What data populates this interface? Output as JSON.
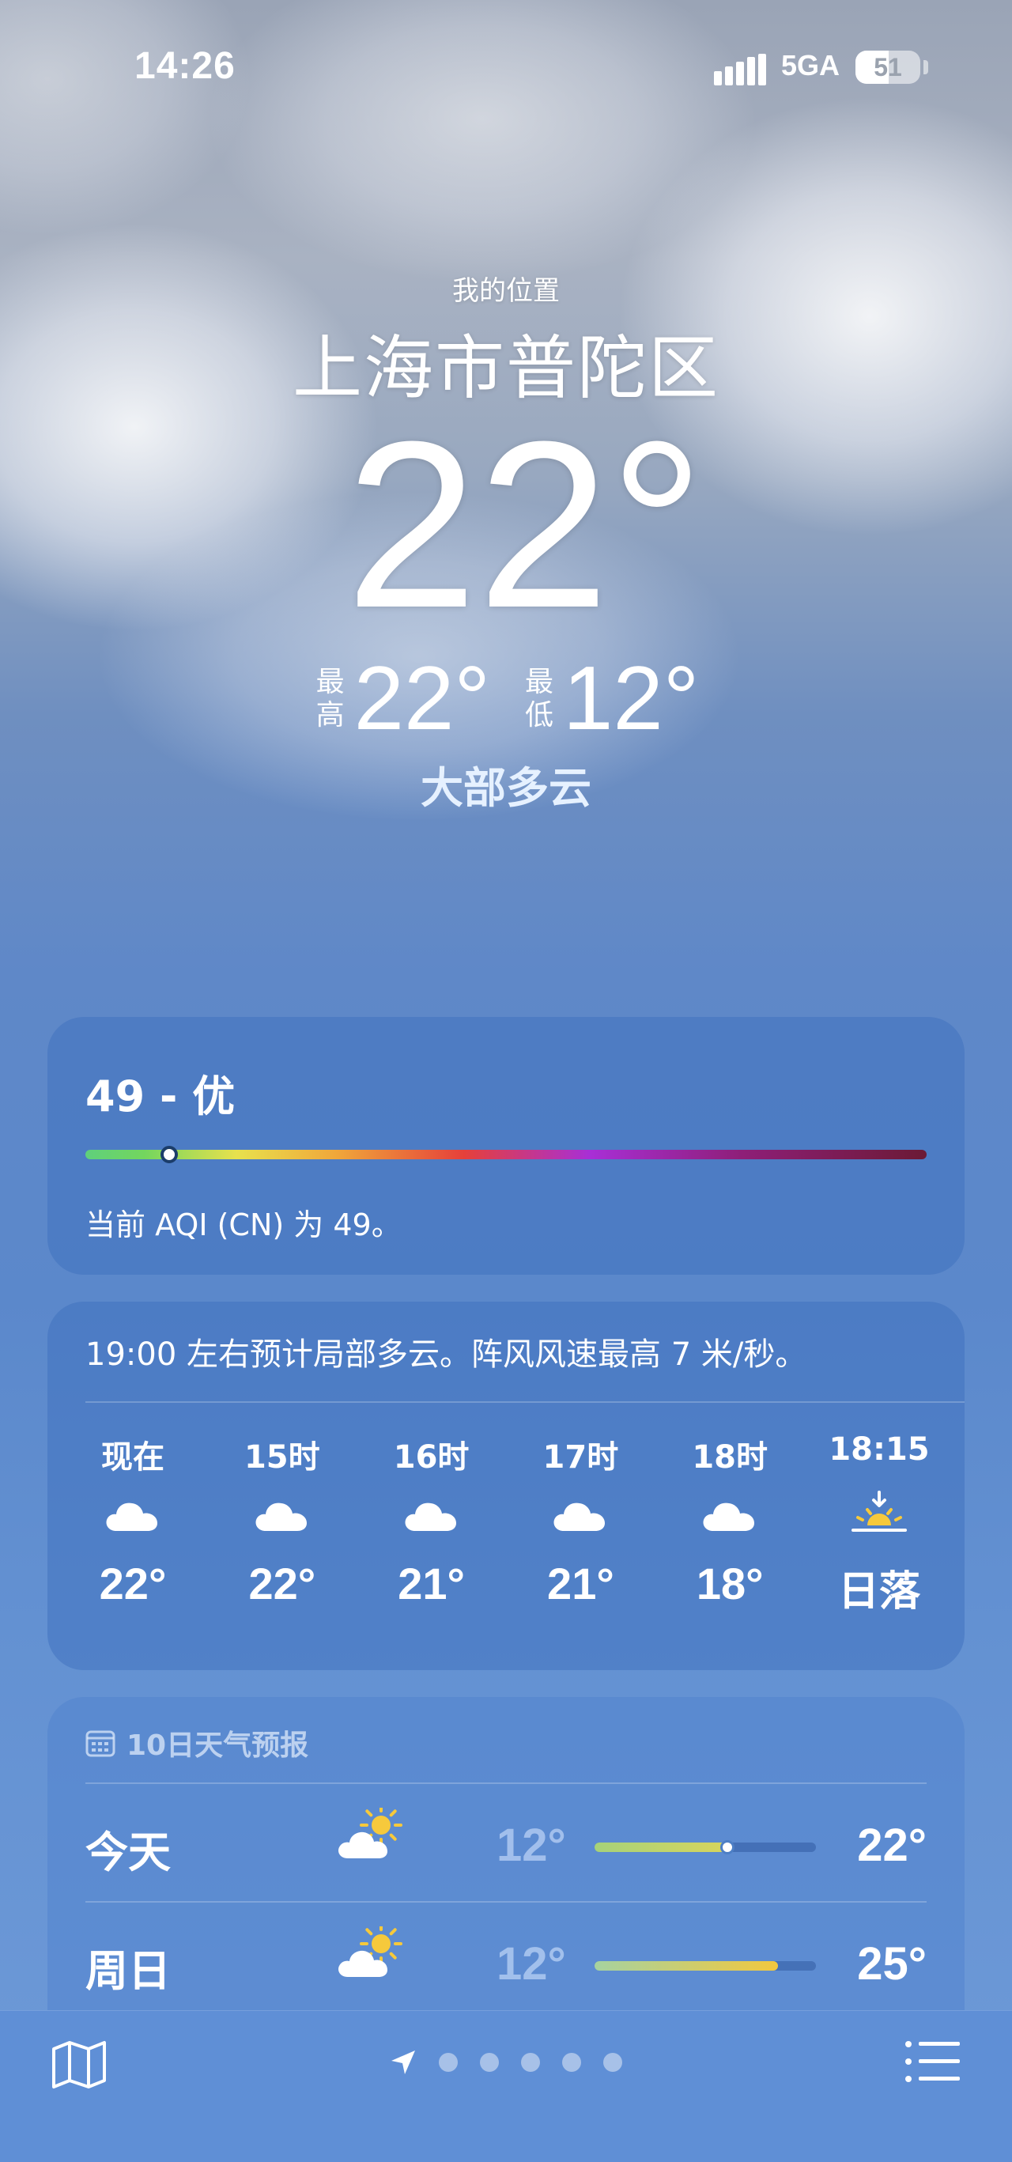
{
  "status_bar": {
    "time": "14:26",
    "network": "5GA",
    "battery": "51",
    "battery_level": 0.51
  },
  "header": {
    "location_label": "我的位置",
    "city": "上海市普陀区",
    "temperature": "22°",
    "high_label": "最高",
    "high": "22°",
    "low_label": "最低",
    "low": "12°",
    "condition": "大部多云"
  },
  "aqi": {
    "title": "49 - 优",
    "description": "当前 AQI (CN) 为 49。",
    "scale_position": 0.1
  },
  "hourly": {
    "summary": "19:00 左右预计局部多云。阵风风速最高 7 米/秒。",
    "items": [
      {
        "label": "现在",
        "icon": "cloud-icon",
        "temp": "22°"
      },
      {
        "label": "15时",
        "icon": "cloud-icon",
        "temp": "22°"
      },
      {
        "label": "16时",
        "icon": "cloud-icon",
        "temp": "21°"
      },
      {
        "label": "17时",
        "icon": "cloud-icon",
        "temp": "21°"
      },
      {
        "label": "18时",
        "icon": "cloud-icon",
        "temp": "18°"
      },
      {
        "label": "18:15",
        "icon": "sunset-icon",
        "temp": "日落"
      }
    ]
  },
  "daily": {
    "title": "10日天气预报",
    "rows": [
      {
        "day": "今天",
        "icon": "partly-sunny-icon",
        "low": "12°",
        "high": "22°",
        "range_start": 0.0,
        "range_end": 0.6,
        "current": 0.6,
        "colors": [
          "#a6d27a",
          "#d8d55c"
        ]
      },
      {
        "day": "周日",
        "icon": "partly-sunny-icon",
        "low": "12°",
        "high": "25°",
        "range_start": 0.0,
        "range_end": 0.83,
        "current": null,
        "colors": [
          "#a6d2a0",
          "#f2c83e"
        ]
      }
    ]
  },
  "toolbar": {
    "page_count": 5
  }
}
